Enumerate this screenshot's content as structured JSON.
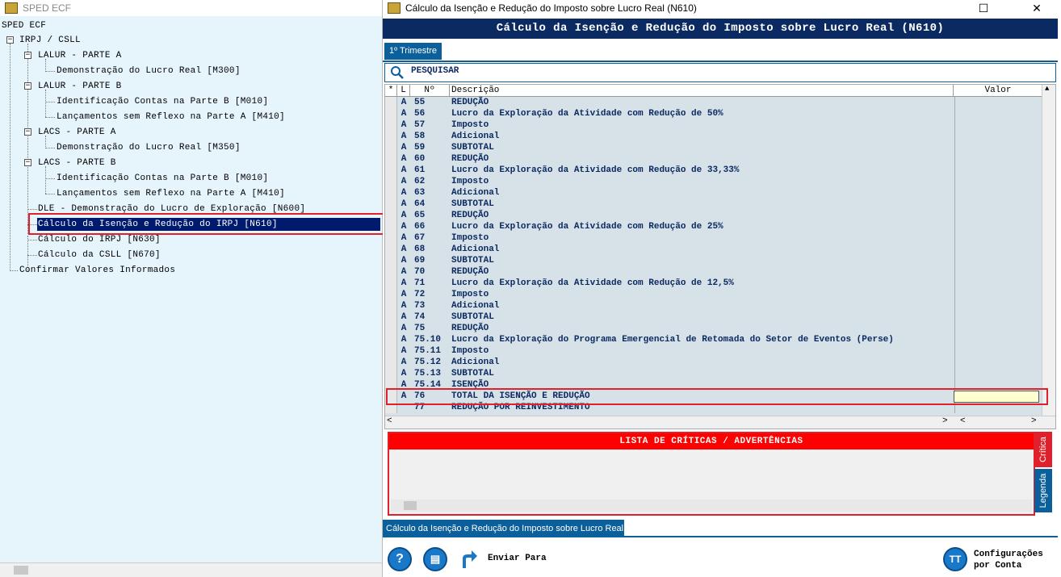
{
  "left_window": {
    "title": "SPED ECF",
    "tree": {
      "root": "SPED ECF",
      "nodes": [
        {
          "label": "IRPJ / CSLL"
        },
        {
          "label": "LALUR - PARTE A"
        },
        {
          "label": "Demonstração do Lucro Real [M300]"
        },
        {
          "label": "LALUR - PARTE B"
        },
        {
          "label": "Identificação Contas na Parte B [M010]"
        },
        {
          "label": "Lançamentos sem Reflexo na Parte A [M410]"
        },
        {
          "label": "LACS - PARTE A"
        },
        {
          "label": "Demonstração do Lucro Real [M350]"
        },
        {
          "label": "LACS - PARTE B"
        },
        {
          "label": "Identificação Contas na Parte B [M010]"
        },
        {
          "label": "Lançamentos sem Reflexo na Parte A [M410]"
        },
        {
          "label": "DLE - Demonstração do Lucro de Exploração [N600]"
        },
        {
          "label": "Cálculo da Isenção e Redução do IRPJ [N610]"
        },
        {
          "label": "Cálculo do IRPJ [N630]"
        },
        {
          "label": "Cálculo da CSLL [N670]"
        },
        {
          "label": "Confirmar Valores Informados"
        }
      ]
    }
  },
  "right_window": {
    "title": "Cálculo da Isenção e Redução do Imposto sobre Lucro Real (N610)",
    "header": "Cálculo da Isenção e Redução do Imposto sobre Lucro Real (N610)",
    "tab": "1º Trimestre",
    "search_label": "PESQUISAR",
    "grid": {
      "columns": [
        "*",
        "L",
        "Nº",
        "Descrição",
        "Valor"
      ],
      "rows": [
        {
          "l": "A",
          "n": "55",
          "d": "REDUÇÃO"
        },
        {
          "l": "A",
          "n": "56",
          "d": "Lucro da Exploração da Atividade com Redução de 50%"
        },
        {
          "l": "A",
          "n": "57",
          "d": "Imposto"
        },
        {
          "l": "A",
          "n": "58",
          "d": "Adicional"
        },
        {
          "l": "A",
          "n": "59",
          "d": "SUBTOTAL"
        },
        {
          "l": "A",
          "n": "60",
          "d": "REDUÇÃO"
        },
        {
          "l": "A",
          "n": "61",
          "d": "Lucro da Exploração da Atividade com Redução de 33,33%"
        },
        {
          "l": "A",
          "n": "62",
          "d": "Imposto"
        },
        {
          "l": "A",
          "n": "63",
          "d": "Adicional"
        },
        {
          "l": "A",
          "n": "64",
          "d": "SUBTOTAL"
        },
        {
          "l": "A",
          "n": "65",
          "d": "REDUÇÃO"
        },
        {
          "l": "A",
          "n": "66",
          "d": "Lucro da Exploração da Atividade com Redução de 25%"
        },
        {
          "l": "A",
          "n": "67",
          "d": "Imposto"
        },
        {
          "l": "A",
          "n": "68",
          "d": "Adicional"
        },
        {
          "l": "A",
          "n": "69",
          "d": "SUBTOTAL"
        },
        {
          "l": "A",
          "n": "70",
          "d": "REDUÇÃO"
        },
        {
          "l": "A",
          "n": "71",
          "d": "Lucro da Exploração da Atividade com Redução de 12,5%"
        },
        {
          "l": "A",
          "n": "72",
          "d": "Imposto"
        },
        {
          "l": "A",
          "n": "73",
          "d": "Adicional"
        },
        {
          "l": "A",
          "n": "74",
          "d": "SUBTOTAL"
        },
        {
          "l": "A",
          "n": "75",
          "d": "REDUÇÃO"
        },
        {
          "l": "A",
          "n": "75.10",
          "d": "Lucro da Exploração do Programa Emergencial de Retomada do Setor de Eventos (Perse)"
        },
        {
          "l": "A",
          "n": "75.11",
          "d": "Imposto"
        },
        {
          "l": "A",
          "n": "75.12",
          "d": "Adicional"
        },
        {
          "l": "A",
          "n": "75.13",
          "d": "SUBTOTAL"
        },
        {
          "l": "A",
          "n": "75.14",
          "d": "ISENÇÃO"
        },
        {
          "l": "A",
          "n": "76",
          "d": "TOTAL DA ISENÇÃO E REDUÇÃO"
        },
        {
          "l": "",
          "n": "77",
          "d": "REDUÇÃO POR REINVESTIMENTO"
        }
      ]
    },
    "critica_header": "LISTA DE CRÍTICAS / ADVERTÊNCIAS",
    "side_tabs": {
      "critica": "Crítica",
      "legenda": "Legenda"
    },
    "bottom_tab": "Cálculo da Isenção e Redução do Imposto sobre Lucro Real",
    "toolbar": {
      "enviar": "Enviar Para",
      "config_line1": "Configurações",
      "config_line2": "por Conta"
    }
  },
  "colors": {
    "header_bg": "#0b2a62",
    "tab_bg": "#0b5f9a",
    "alert_red": "#ff0000",
    "grid_bg": "#d6e1e8",
    "tree_bg": "#e6f4fb"
  }
}
